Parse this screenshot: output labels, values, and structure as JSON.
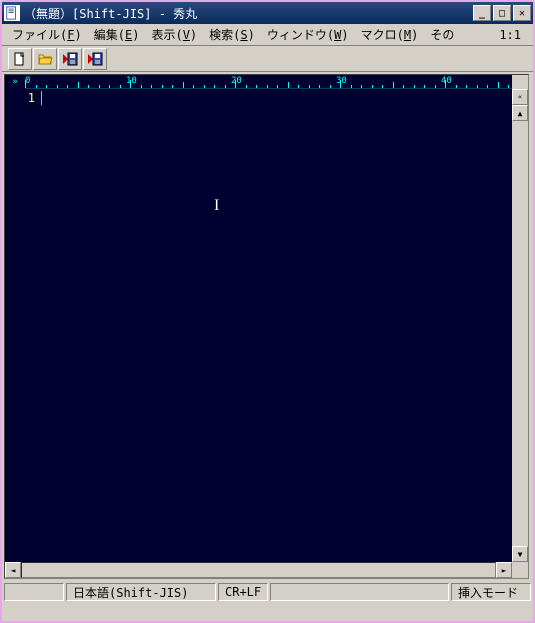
{
  "title": "（無題）[Shift-JIS] - 秀丸",
  "menu": {
    "file": {
      "label": "ファイル",
      "key": "F"
    },
    "edit": {
      "label": "編集",
      "key": "E"
    },
    "view": {
      "label": "表示",
      "key": "V"
    },
    "search": {
      "label": "検索",
      "key": "S"
    },
    "window": {
      "label": "ウィンドウ",
      "key": "W"
    },
    "macro": {
      "label": "マクロ",
      "key": "M"
    },
    "other": {
      "label": "その"
    }
  },
  "cursor_pos": "1:1",
  "toolbar": {
    "new": "new-file-icon",
    "open": "open-folder-icon",
    "save": "save-icon",
    "save2": "save-play-icon"
  },
  "ruler": {
    "marks": [
      0,
      10,
      20,
      30,
      40
    ],
    "gutter_mark": "»"
  },
  "editor": {
    "line_numbers": [
      "1"
    ],
    "content": ""
  },
  "status": {
    "encoding": "日本語(Shift-JIS)",
    "newline": "CR+LF",
    "mode": "挿入モード"
  },
  "colors": {
    "editor_bg": "#000030",
    "ruler_fg": "#00ffff",
    "lineno_fg": "#ffff80"
  }
}
